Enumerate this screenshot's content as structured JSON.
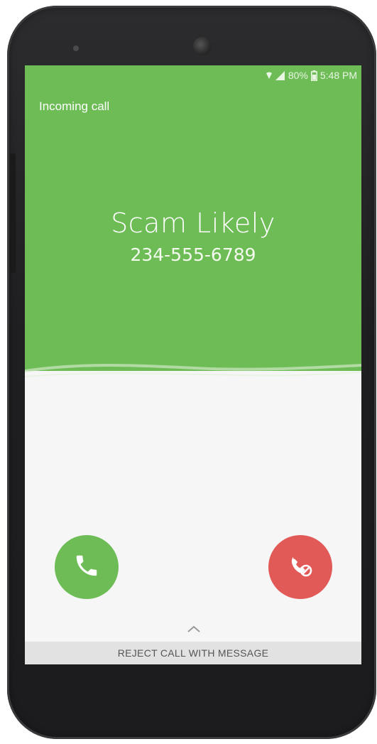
{
  "status_bar": {
    "battery": "80%",
    "time": "5:48 PM"
  },
  "call": {
    "state_label": "Incoming call",
    "caller_name": "Scam Likely",
    "caller_number": "234-555-6789"
  },
  "actions": {
    "answer_icon": "phone-icon",
    "reject_icon": "phone-hangup-block-icon",
    "expand_icon": "chevron-up-icon",
    "reject_message_label": "REJECT CALL WITH MESSAGE"
  },
  "colors": {
    "header_green": "#6dbc56",
    "answer_green": "#6dbc56",
    "reject_red": "#e25a57",
    "body_bg": "#f6f6f6",
    "phone_frame": "#242426"
  }
}
